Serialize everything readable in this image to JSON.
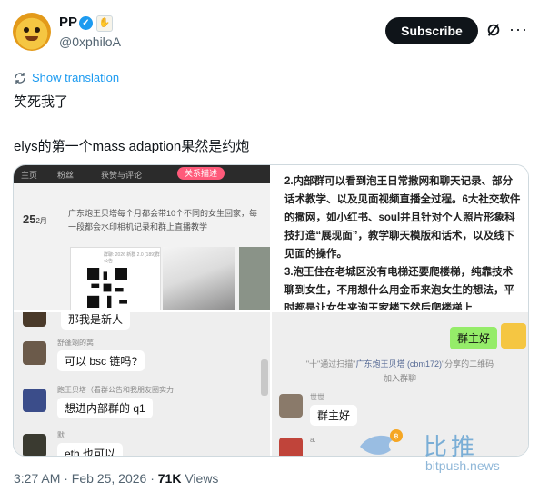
{
  "post": {
    "author_name": "PP",
    "author_handle": "@0xphiloA",
    "verified_mark": "✓",
    "subscribe_label": "Subscribe",
    "more_label": "···",
    "show_translation": "Show translation",
    "text_line1": "笑死我了",
    "text_line2": "elys的第一个mass adaption果然是约炮",
    "timestamp": "3:27 AM · Feb 25, 2026 · ",
    "views_count": "71K",
    "views_label": " Views",
    "icons": [
      "verified-badge-icon",
      "grok-icon",
      "more-icon",
      "translate-icon"
    ]
  },
  "media": {
    "q1": {
      "tabs": [
        "主页",
        "粉丝",
        "获赞与评论"
      ],
      "active_tab": "关系描述",
      "date_day": "25",
      "date_month": "2月",
      "description": "广东炮王贝塔每个月都会带10个不同的女生回家，每一段都会水印相机记录和群上直播教学",
      "qr_caption": "群聊: 2026 新群 2.0 (189)群公告"
    },
    "q2": {
      "line1": "2.内部群可以看到泡王日常撒网和聊天记录、部分话术教学、以及见面视频直播全过程。6大社交软件的撒网，如小红书、soul并且针对个人照片形象科技打造“展现面”，教学聊天模版和话术，以及线下见面的操作。",
      "line2": "3.泡王住在老城区没有电梯还要爬楼梯，纯靠技术聊到女生，不用想什么用金币来泡女生的想法，平时都是让女生来泡王家楼下然后爬楼梯上"
    },
    "q3": {
      "msg_top": "那我是新人",
      "name1": "舒蓬翊的莴",
      "msg1": "可以 bsc 链吗?",
      "name2": "跑王贝塔（看群公告和我朋友圈实力",
      "msg2": "想进内部群的 q1",
      "name3": "默",
      "msg3": "eth 也可以"
    },
    "q4": {
      "my_msg": "群主好",
      "sys_prefix": "\"十\"通过扫描\"",
      "sys_link": "广东炮王贝塔 (cbm172)",
      "sys_suffix": "\"分享的二维码",
      "sys_line2": "加入群聊",
      "name1": "世世",
      "msg1": "群主好",
      "name2": "a."
    }
  },
  "watermark": {
    "cn": "比推",
    "en": "bitpush.news"
  },
  "colors": {
    "link": "#1d9bf0",
    "verified": "#1d9bf0",
    "subscribe_bg": "#0f1419",
    "wechat_green": "#95ec69",
    "secondary_text": "#536471"
  }
}
